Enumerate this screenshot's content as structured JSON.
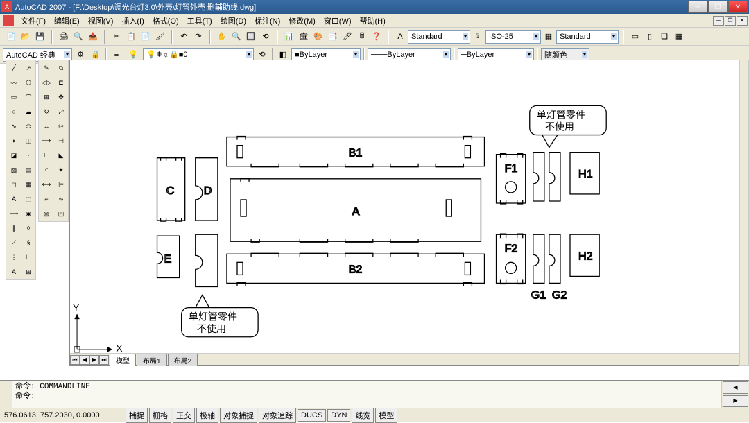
{
  "titlebar": {
    "app": "AutoCAD 2007",
    "file_path": "[F:\\Desktop\\调光台灯3.0\\外壳\\灯管外壳 删辅助线.dwg]"
  },
  "menu": {
    "file": "文件(F)",
    "edit": "编辑(E)",
    "view": "视图(V)",
    "insert": "插入(I)",
    "format": "格式(O)",
    "tools": "工具(T)",
    "draw": "绘图(D)",
    "dim": "标注(N)",
    "modify": "修改(M)",
    "window": "窗口(W)",
    "help": "帮助(H)"
  },
  "styles": {
    "text": "Standard",
    "dim": "ISO-25",
    "table": "Standard"
  },
  "workspace": {
    "name": "AutoCAD 经典"
  },
  "layer": {
    "current": "0"
  },
  "props": {
    "color": "ByLayer",
    "ltype": "ByLayer",
    "lweight": "ByLayer",
    "plotstyle": "随颜色"
  },
  "tabs": {
    "model": "模型",
    "layout1": "布局1",
    "layout2": "布局2"
  },
  "command": {
    "prompt_prefix": "命令:",
    "last": "COMMANDLINE"
  },
  "status": {
    "coords": "576.0613, 757.2030, 0.0000",
    "snap": "捕捉",
    "grid": "栅格",
    "ortho": "正交",
    "polar": "极轴",
    "osnap": "对象捕捉",
    "otrack": "对象追踪",
    "ducs": "DUCS",
    "dyn": "DYN",
    "lwt": "线宽",
    "model": "模型"
  },
  "parts": {
    "A": "A",
    "B1": "B1",
    "B2": "B2",
    "C": "C",
    "D": "D",
    "E": "E",
    "F1": "F1",
    "F2": "F2",
    "G1": "G1",
    "G2": "G2",
    "H1": "H1",
    "H2": "H2"
  },
  "callouts": {
    "note_single_tube": "单灯管零件\n不使用"
  },
  "ucs": {
    "x": "X",
    "y": "Y"
  }
}
